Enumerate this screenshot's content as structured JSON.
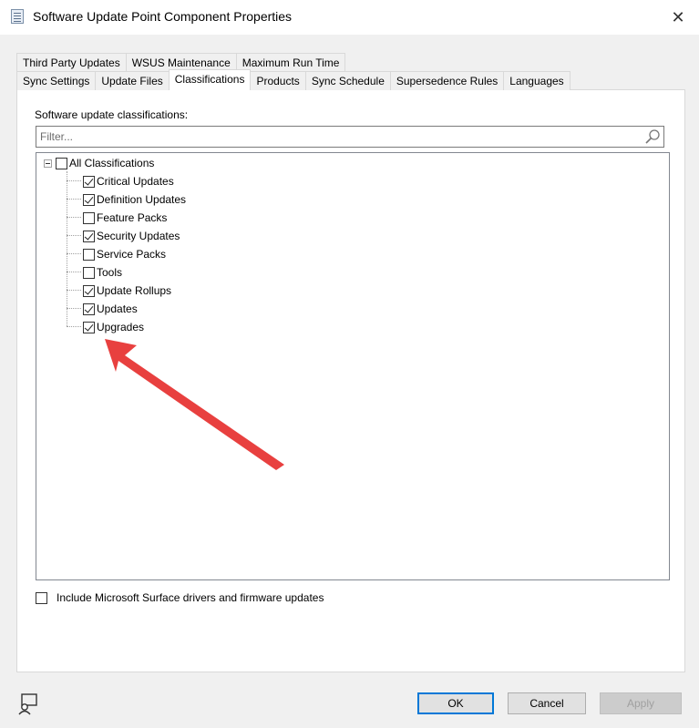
{
  "window": {
    "title": "Software Update Point Component Properties",
    "close_glyph": "✕",
    "icon": "properties-icon"
  },
  "tabs": {
    "row1": [
      {
        "label": "Third Party Updates"
      },
      {
        "label": "WSUS Maintenance"
      },
      {
        "label": "Maximum Run Time"
      }
    ],
    "row2": [
      {
        "label": "Sync Settings"
      },
      {
        "label": "Update Files"
      },
      {
        "label": "Classifications",
        "active": true
      },
      {
        "label": "Products"
      },
      {
        "label": "Sync Schedule"
      },
      {
        "label": "Supersedence Rules"
      },
      {
        "label": "Languages"
      }
    ]
  },
  "classifications": {
    "label": "Software update classifications:",
    "filter_placeholder": "Filter...",
    "root": {
      "label": "All Classifications",
      "checked": false,
      "expanded": true
    },
    "items": [
      {
        "label": "Critical Updates",
        "checked": true
      },
      {
        "label": "Definition Updates",
        "checked": true
      },
      {
        "label": "Feature Packs",
        "checked": false
      },
      {
        "label": "Security Updates",
        "checked": true
      },
      {
        "label": "Service Packs",
        "checked": false
      },
      {
        "label": "Tools",
        "checked": false
      },
      {
        "label": "Update Rollups",
        "checked": true
      },
      {
        "label": "Updates",
        "checked": true
      },
      {
        "label": "Upgrades",
        "checked": true
      }
    ]
  },
  "surface": {
    "label": "Include Microsoft Surface drivers and firmware updates",
    "checked": false
  },
  "buttons": {
    "ok": "OK",
    "cancel": "Cancel",
    "apply": "Apply"
  },
  "annotation": {
    "arrow_color": "#e8403f"
  }
}
